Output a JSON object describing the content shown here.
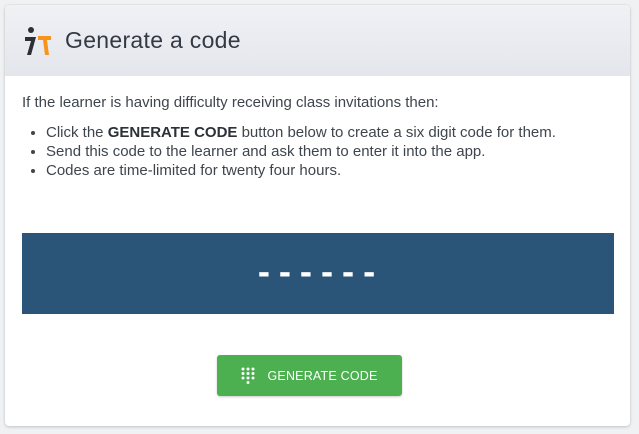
{
  "header": {
    "title": "Generate a code",
    "logo_icon": "brand-logo-icon"
  },
  "body": {
    "intro": "If the learner is having difficulty receiving class invitations then:",
    "bullet_1_prefix": "Click the ",
    "bullet_1_bold": "GENERATE CODE",
    "bullet_1_suffix": " button below to create a six digit code for them.",
    "bullet_2": "Send this code to the learner and ask them to enter it into the app.",
    "bullet_3": "Codes are time-limited for twenty four hours."
  },
  "code_display": {
    "value": "------"
  },
  "generate_button": {
    "label": "GENERATE CODE",
    "icon": "dialpad-icon"
  },
  "colors": {
    "code_panel_bg": "#2a5478",
    "button_bg": "#4caf50",
    "logo_orange": "#f7941d",
    "logo_dark": "#2b2f36"
  }
}
